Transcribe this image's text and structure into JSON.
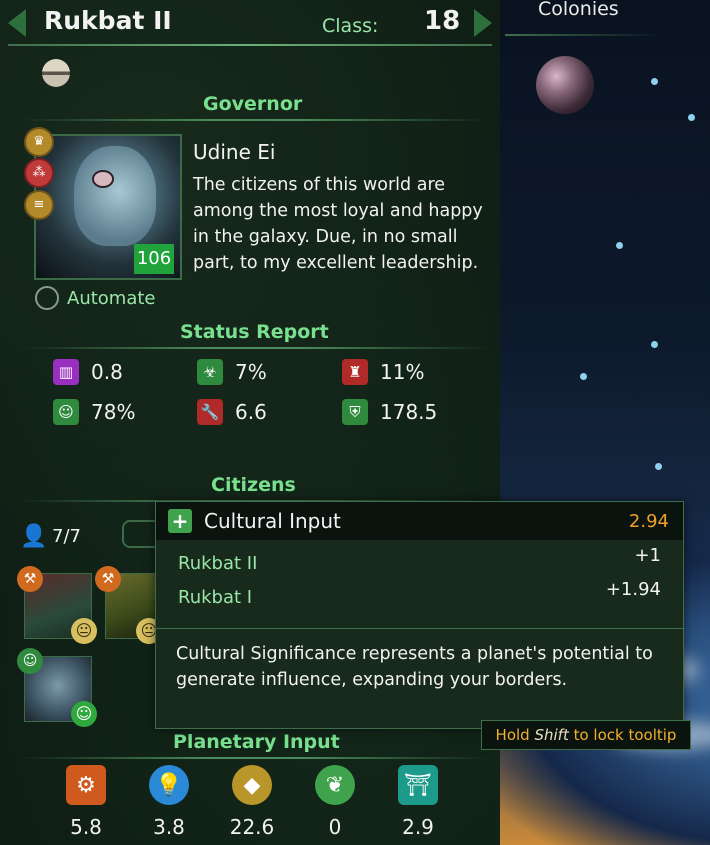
{
  "planet": {
    "name": "Rukbat II",
    "class_label": "Class:",
    "class_value": "18"
  },
  "colonies": {
    "title": "Colonies"
  },
  "governor": {
    "section_title": "Governor",
    "name": "Udine Ei",
    "quote": "The citizens of this world are among the most loyal and happy in the galaxy. Due, in no small part, to my excellent leadership.",
    "level": "106",
    "automate_label": "Automate"
  },
  "status": {
    "section_title": "Status Report",
    "items": [
      {
        "icon": "influence-pillar-icon",
        "value": "0.8",
        "color": "#9a2ec0"
      },
      {
        "icon": "biohazard-icon",
        "value": "7%",
        "color": "#2f8a3e"
      },
      {
        "icon": "crime-icon",
        "value": "11%",
        "color": "#b02a2a"
      },
      {
        "icon": "approval-smiley-icon",
        "value": "78%",
        "color": "#2f8a3e"
      },
      {
        "icon": "manufacturing-wrench-icon",
        "value": "6.6",
        "color": "#b02a2a"
      },
      {
        "icon": "defense-shield-icon",
        "value": "178.5",
        "color": "#2f8a3e"
      }
    ]
  },
  "citizens": {
    "section_title": "Citizens",
    "count": "7/7"
  },
  "planetary_input": {
    "section_title": "Planetary Input",
    "items": [
      {
        "icon": "industry-gear-icon",
        "value": "5.8",
        "color": "#d05a1e"
      },
      {
        "icon": "science-lightbulb-icon",
        "value": "3.8",
        "color": "#2a8ad8"
      },
      {
        "icon": "wealth-gem-icon",
        "value": "22.6",
        "color": "#b8962a"
      },
      {
        "icon": "food-leaf-icon",
        "value": "0",
        "color": "#3fa34e"
      },
      {
        "icon": "culture-building-icon",
        "value": "2.9",
        "color": "#1c9a8a"
      }
    ]
  },
  "tooltip": {
    "title": "Cultural Input",
    "total": "2.94",
    "rows": [
      {
        "label": "Rukbat II",
        "value": "+1"
      },
      {
        "label": "Rukbat I",
        "value": "+1.94"
      }
    ],
    "description": "Cultural Significance represents a planet's potential to generate influence, expanding your borders.",
    "hint_prefix": "Hold ",
    "hint_key": "Shift",
    "hint_suffix": " to lock tooltip"
  }
}
